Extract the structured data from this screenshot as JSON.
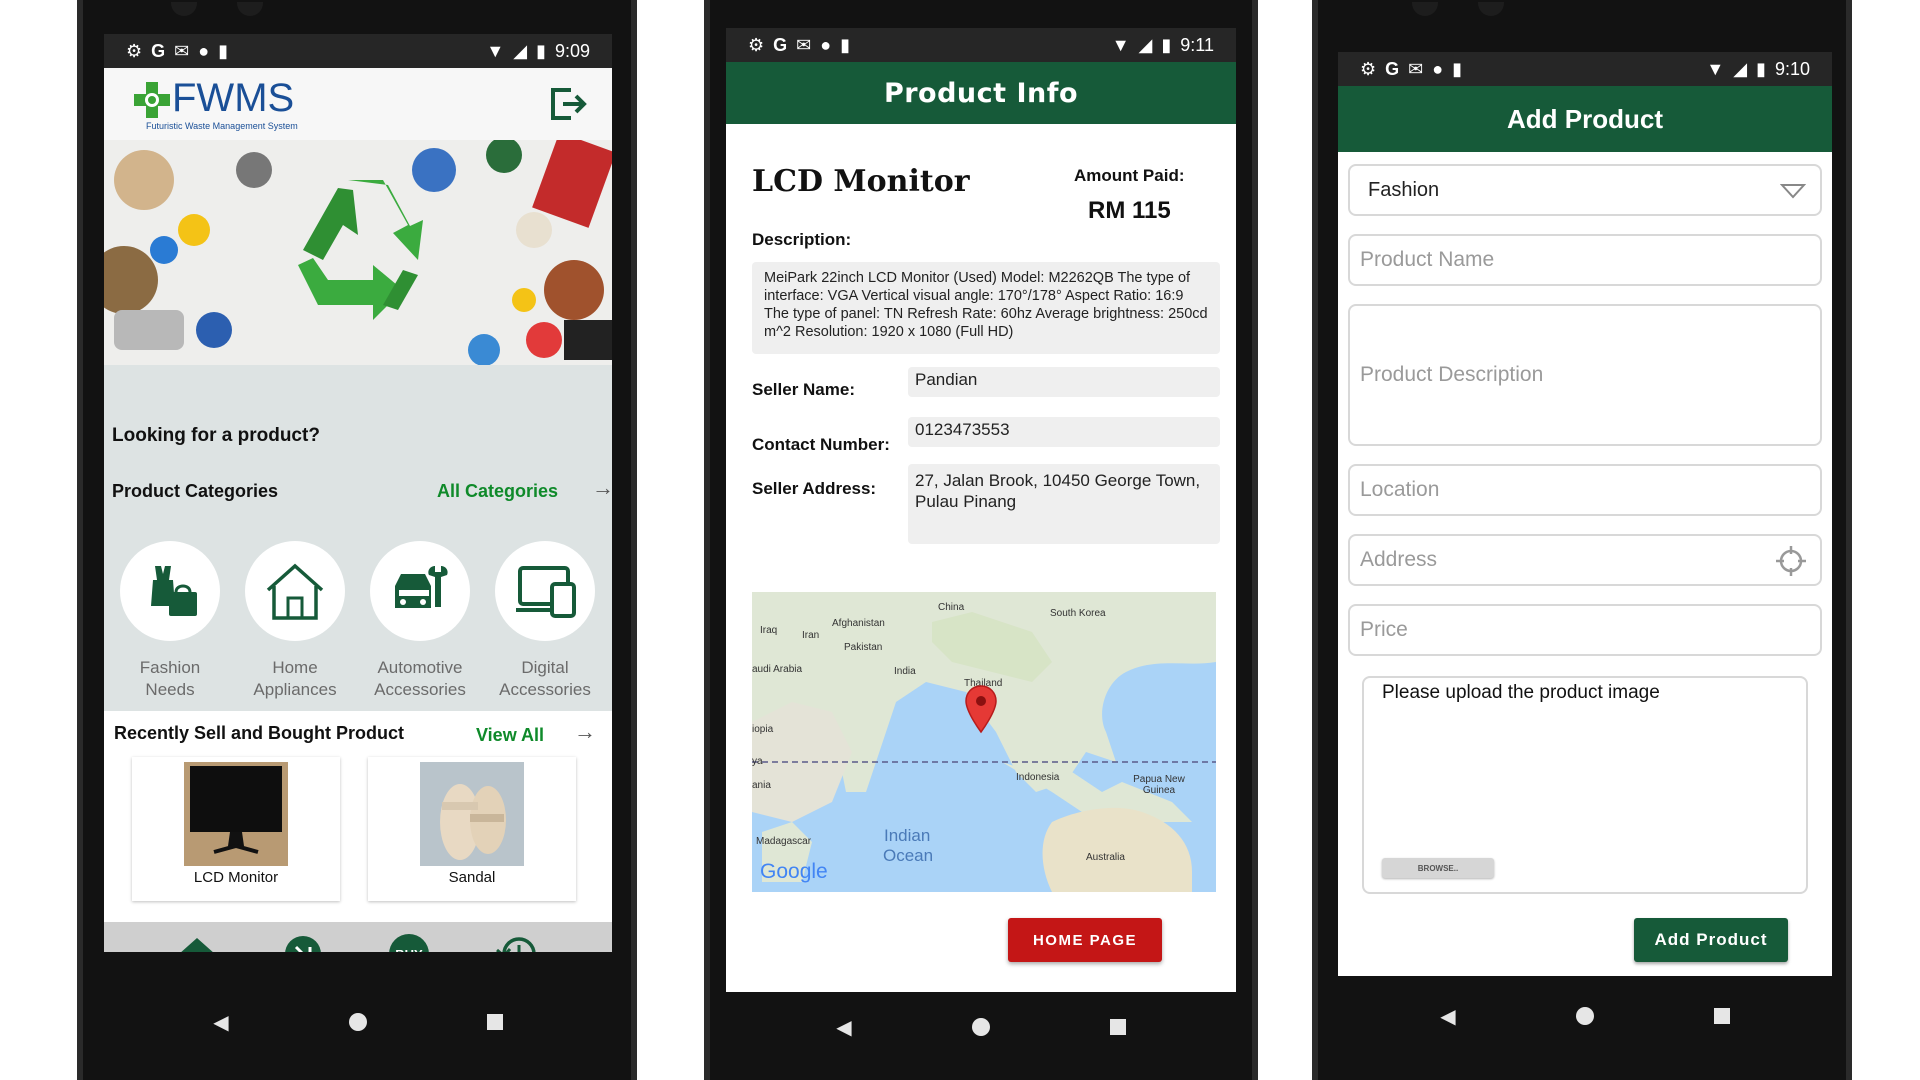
{
  "phone1": {
    "status": {
      "time": "9:09"
    },
    "logo_text": "FWMS",
    "logo_subtitle": "Futuristic Waste Management System",
    "search_heading": "Looking for a product?",
    "categories_heading": "Product Categories",
    "all_categories_link": "All Categories",
    "categories": [
      {
        "line1": "Fashion",
        "line2": "Needs",
        "icon": "fashion-icon"
      },
      {
        "line1": "Home",
        "line2": "Appliances",
        "icon": "home-icon"
      },
      {
        "line1": "Automotive",
        "line2": "Accessories",
        "icon": "automotive-icon"
      },
      {
        "line1": "Digital",
        "line2": "Accessories",
        "icon": "digital-icon"
      }
    ],
    "recent_heading": "Recently Sell and Bought Product",
    "view_all_link": "View All",
    "products": [
      {
        "name": "LCD Monitor"
      },
      {
        "name": "Sandal"
      }
    ],
    "tabs": {
      "buy_label": "BUY"
    }
  },
  "phone2": {
    "status": {
      "time": "9:11"
    },
    "title": "Product Info",
    "product_name": "LCD Monitor",
    "amount_label": "Amount Paid:",
    "amount_value": "RM 115",
    "description_label": "Description:",
    "description": "MeiPark 22inch LCD Monitor (Used) Model: M2262QB The type of interface: VGA Vertical visual angle: 170°/178° Aspect Ratio: 16:9 The type of panel: TN Refresh Rate: 60hz Average brightness: 250cd m^2 Resolution: 1920 x 1080 (Full HD)",
    "seller_name_label": "Seller Name:",
    "seller_name": "Pandian",
    "contact_label": "Contact Number:",
    "contact": "0123473553",
    "address_label": "Seller Address:",
    "address": "27, Jalan Brook, 10450 George Town, Pulau Pinang",
    "map_labels": {
      "china": "China",
      "south_korea": "South Korea",
      "afghanistan": "Afghanistan",
      "iraq": "Iraq",
      "iran": "Iran",
      "pakistan": "Pakistan",
      "saudi": "audi Arabia",
      "india": "India",
      "thailand": "Thailand",
      "ethiopia": "iopia",
      "kenya": "ya",
      "tanzania": "ania",
      "indonesia": "Indonesia",
      "png": "Papua New Guinea",
      "madagascar": "Madagascar",
      "indian_ocean_1": "Indian",
      "indian_ocean_2": "Ocean",
      "australia": "Australia",
      "google": "Google"
    },
    "home_button": "HOME PAGE"
  },
  "phone3": {
    "status": {
      "time": "9:10"
    },
    "title": "Add Product",
    "category_value": "Fashion",
    "name_placeholder": "Product Name",
    "desc_placeholder": "Product Description",
    "location_placeholder": "Location",
    "address_placeholder": "Address",
    "price_placeholder": "Price",
    "upload_text": "Please upload the product image",
    "browse_label": "BROWSE..",
    "submit_label": "Add Product"
  },
  "colors": {
    "brand_green": "#165a39",
    "accent_red": "#c41616",
    "link_green": "#0f8a2a"
  }
}
